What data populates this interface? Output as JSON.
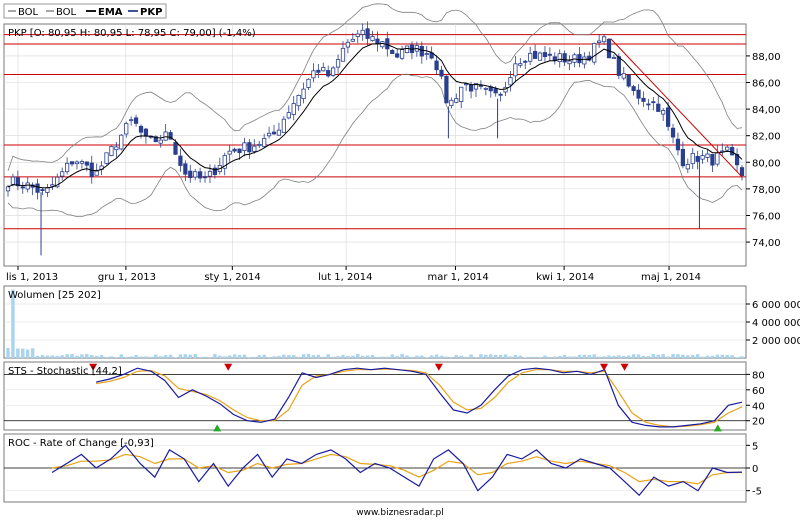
{
  "legend": [
    {
      "label": "BOL",
      "color": "#888888",
      "bold": false
    },
    {
      "label": "BOL",
      "color": "#888888",
      "bold": false
    },
    {
      "label": "EMA",
      "color": "#000000",
      "bold": true
    },
    {
      "label": "PKP",
      "color": "#2b3f8f",
      "bold": true
    }
  ],
  "footer": "www.biznesradar.pl",
  "chart_data": [
    {
      "type": "candlestick",
      "title": "PKP [O: 80,95  H: 80,95  L: 78,95  C: 79,00]  (-1,4%)",
      "ylim": [
        72.2,
        90.4
      ],
      "ytick_labels": [
        "74,00",
        "76,00",
        "78,00",
        "80,00",
        "82,00",
        "84,00",
        "86,00",
        "88,00"
      ],
      "yticks": [
        74,
        76,
        78,
        80,
        82,
        84,
        86,
        88
      ],
      "xtick_labels": [
        "lis 1, 2013",
        "gru 1, 2013",
        "sty 1, 2014",
        "lut 1, 2014",
        "mar 1, 2014",
        "kwi 1, 2014",
        "maj 1, 2014"
      ],
      "horizontal_levels": [
        75.0,
        78.9,
        81.3,
        86.6,
        88.9,
        89.6
      ],
      "trendline": [
        [
          0.821,
          89.3
        ],
        [
          1.0,
          78.9
        ]
      ],
      "colors": {
        "candle": "#2b3f8f",
        "ema": "#000000",
        "bollinger": "#808080",
        "levels": "#cc0000",
        "grid": "#d8d8d8"
      },
      "waypoints": [
        [
          0.0,
          78.6
        ],
        [
          0.03,
          78.2
        ],
        [
          0.05,
          77.6
        ],
        [
          0.07,
          78.9
        ],
        [
          0.09,
          80.3
        ],
        [
          0.12,
          79.1
        ],
        [
          0.15,
          81.7
        ],
        [
          0.17,
          83.2
        ],
        [
          0.19,
          81.4
        ],
        [
          0.22,
          82.1
        ],
        [
          0.24,
          79.2
        ],
        [
          0.27,
          78.6
        ],
        [
          0.3,
          80.8
        ],
        [
          0.33,
          81.2
        ],
        [
          0.36,
          81.9
        ],
        [
          0.39,
          84.6
        ],
        [
          0.42,
          87.1
        ],
        [
          0.44,
          86.4
        ],
        [
          0.46,
          88.9
        ],
        [
          0.48,
          89.6
        ],
        [
          0.51,
          89.0
        ],
        [
          0.53,
          88.0
        ],
        [
          0.55,
          88.6
        ],
        [
          0.58,
          88.1
        ],
        [
          0.6,
          84.2
        ],
        [
          0.62,
          85.9
        ],
        [
          0.64,
          85.5
        ],
        [
          0.67,
          84.7
        ],
        [
          0.69,
          87.6
        ],
        [
          0.71,
          88.1
        ],
        [
          0.74,
          87.9
        ],
        [
          0.77,
          87.7
        ],
        [
          0.79,
          88.0
        ],
        [
          0.81,
          89.3
        ],
        [
          0.83,
          87.0
        ],
        [
          0.85,
          85.3
        ],
        [
          0.87,
          84.7
        ],
        [
          0.89,
          84.1
        ],
        [
          0.9,
          82.4
        ],
        [
          0.92,
          80.1
        ],
        [
          0.94,
          80.4
        ],
        [
          0.96,
          80.2
        ],
        [
          0.98,
          80.7
        ],
        [
          1.0,
          79.0
        ]
      ]
    },
    {
      "type": "bar",
      "title": "Wolumen [25 202]",
      "ylim": [
        0,
        8000000
      ],
      "yticks": [
        2000000,
        4000000,
        6000000
      ],
      "ytick_labels": [
        "2 000 000",
        "4 000 000",
        "6 000 000"
      ],
      "spike_value": 7600000,
      "color": "#a9d4f0"
    },
    {
      "type": "line",
      "title": "STS - Stochastic [44,2]",
      "ylim": [
        8,
        96
      ],
      "yticks": [
        20,
        40,
        60,
        80
      ],
      "ytick_labels": [
        "20",
        "40",
        "60",
        "80"
      ],
      "levels": [
        20,
        80
      ],
      "series": [
        {
          "color": "#1a1aa0",
          "values": [
            70,
            74,
            80,
            88,
            84,
            72,
            50,
            60,
            52,
            42,
            28,
            20,
            18,
            22,
            50,
            82,
            76,
            80,
            86,
            88,
            86,
            88,
            86,
            84,
            80,
            56,
            34,
            30,
            40,
            60,
            78,
            86,
            88,
            86,
            82,
            84,
            80,
            86,
            40,
            18,
            14,
            12,
            12,
            14,
            16,
            20,
            40,
            44
          ]
        },
        {
          "color": "#e8a317",
          "values": [
            68,
            71,
            76,
            84,
            85,
            78,
            62,
            58,
            54,
            46,
            34,
            24,
            20,
            20,
            34,
            66,
            78,
            80,
            84,
            86,
            86,
            87,
            86,
            85,
            82,
            66,
            44,
            34,
            36,
            50,
            70,
            82,
            86,
            86,
            84,
            84,
            82,
            84,
            58,
            30,
            18,
            14,
            12,
            13,
            15,
            18,
            30,
            38
          ]
        }
      ],
      "sell_markers": [
        0.116,
        0.3,
        0.587,
        0.812,
        0.84
      ],
      "buy_markers": [
        0.285,
        0.967
      ]
    },
    {
      "type": "line",
      "title": "ROC - Rate of Change [-0,93]",
      "ylim": [
        -7.5,
        7.5
      ],
      "yticks": [
        -5,
        0,
        5
      ],
      "ytick_labels": [
        "-5",
        "0",
        "5"
      ],
      "levels": [
        0
      ],
      "series": [
        {
          "color": "#1a1aa0",
          "values": [
            -1,
            1,
            3,
            0,
            2,
            5,
            1,
            -2,
            4,
            2,
            -3,
            1,
            -4,
            0,
            3,
            -2,
            2,
            1,
            3,
            4,
            2,
            -1,
            1,
            0,
            -2,
            -4,
            2,
            4,
            1,
            -5,
            -2,
            3,
            2,
            4,
            1,
            0,
            2,
            1,
            0,
            -3,
            -6,
            -2,
            -4,
            -3,
            -5,
            0,
            -1,
            -0.9
          ]
        },
        {
          "color": "#e8a317",
          "values": [
            0,
            0.5,
            1.5,
            1.5,
            1.8,
            3,
            2.5,
            1,
            2,
            2,
            0,
            0.5,
            -1,
            -0.5,
            1,
            0,
            0.8,
            1,
            2,
            3,
            2.5,
            1,
            0.8,
            0.5,
            -0.5,
            -2,
            -0.5,
            1.5,
            1,
            -1.5,
            -1,
            1,
            1.5,
            2.5,
            1.5,
            1,
            1.5,
            1,
            0.5,
            -1,
            -3,
            -2.5,
            -3,
            -3,
            -3.5,
            -1.5,
            -1,
            -1
          ]
        }
      ]
    }
  ]
}
